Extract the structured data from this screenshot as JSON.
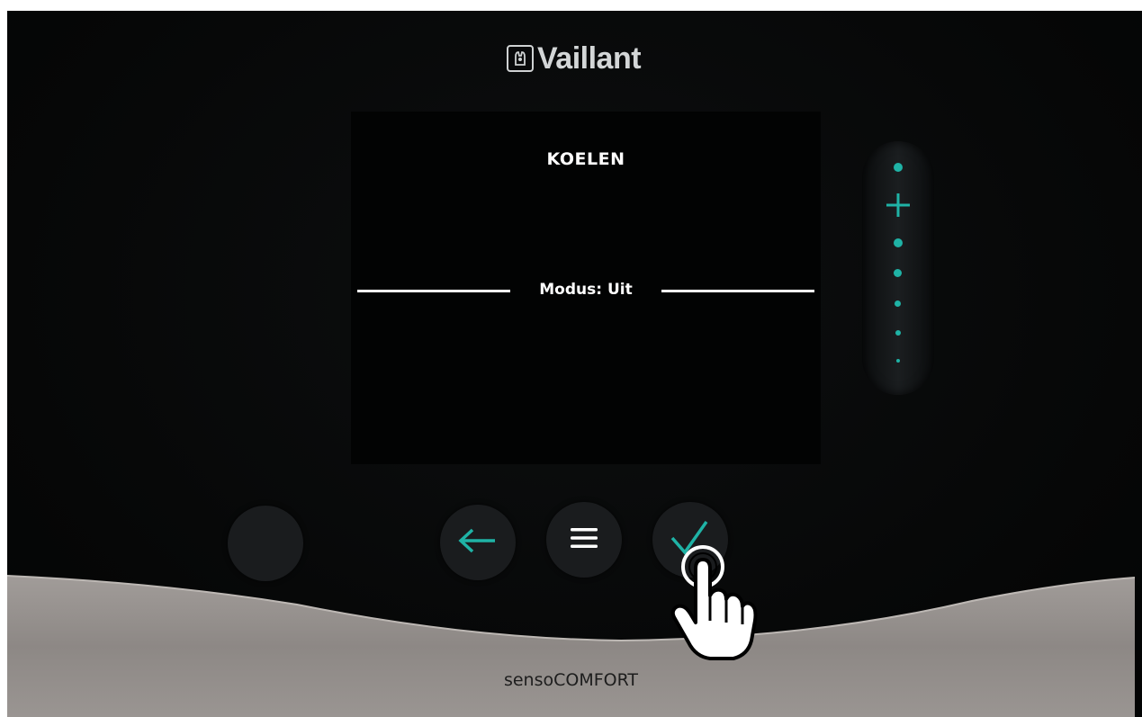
{
  "brand": {
    "name": "Vaillant",
    "logo_icon": "vaillant-hare-logo-icon"
  },
  "screen": {
    "title": "KOELEN",
    "mode_label": "Modus: Uit"
  },
  "slider": {
    "increase_icon": "plus-icon",
    "dots": 6,
    "color": "#1fb3a6"
  },
  "buttons": [
    {
      "name": "blank-button",
      "icon": "none"
    },
    {
      "name": "back-button",
      "icon": "arrow-left-icon"
    },
    {
      "name": "menu-button",
      "icon": "hamburger-menu-icon"
    },
    {
      "name": "confirm-button",
      "icon": "checkmark-icon"
    }
  ],
  "product": {
    "name": "sensoCOMFORT"
  },
  "overlay": {
    "pointer_icon": "pointing-hand-cursor-icon"
  },
  "colors": {
    "accent": "#1fb3a6",
    "background": "#060707",
    "bezel": "#8f8a87"
  }
}
